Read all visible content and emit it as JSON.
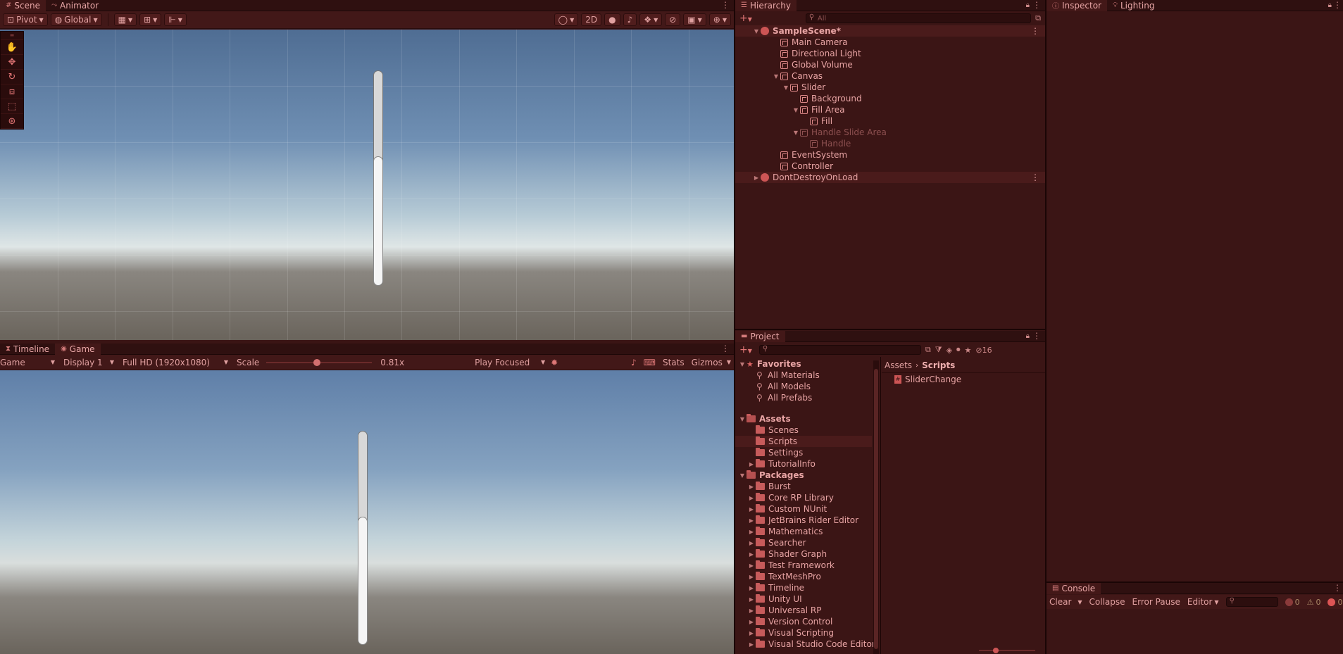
{
  "scene_window": {
    "tabs": [
      {
        "label": "Scene",
        "icon": "grid-icon"
      },
      {
        "label": "Animator",
        "icon": "animator-icon"
      }
    ],
    "toolbar": {
      "pivot_label": "Pivot",
      "global_label": "Global",
      "mode_2d_label": "2D"
    },
    "tools": [
      "hand-tool-icon",
      "move-tool-icon",
      "rotate-tool-icon",
      "scale-tool-icon",
      "rect-tool-icon",
      "transform-tool-icon"
    ],
    "slider_fill_fraction": 0.6
  },
  "game_window": {
    "tabs": [
      {
        "label": "Timeline",
        "icon": "timeline-icon"
      },
      {
        "label": "Game",
        "icon": "gamepad-icon"
      }
    ],
    "toolbar": {
      "game_select": "Game",
      "display_select": "Display 1",
      "resolution_select": "Full HD (1920x1080)",
      "scale_label": "Scale",
      "scale_value": "0.81x",
      "scale_fraction": 0.48,
      "play_focused": "Play Focused",
      "stats_label": "Stats",
      "gizmos_label": "Gizmos"
    },
    "slider_fill_fraction": 0.6
  },
  "hierarchy": {
    "tab_label": "Hierarchy",
    "search_placeholder": "All",
    "rows": [
      {
        "label": "SampleScene*",
        "depth": 0,
        "type": "scene",
        "expanded": true,
        "dim": false,
        "bold": true
      },
      {
        "label": "Main Camera",
        "depth": 1,
        "type": "object",
        "expanded": null,
        "dim": false
      },
      {
        "label": "Directional Light",
        "depth": 1,
        "type": "object",
        "expanded": null,
        "dim": false
      },
      {
        "label": "Global Volume",
        "depth": 1,
        "type": "object",
        "expanded": null,
        "dim": false
      },
      {
        "label": "Canvas",
        "depth": 1,
        "type": "object",
        "expanded": true,
        "dim": false
      },
      {
        "label": "Slider",
        "depth": 2,
        "type": "object",
        "expanded": true,
        "dim": false
      },
      {
        "label": "Background",
        "depth": 3,
        "type": "object",
        "expanded": null,
        "dim": false
      },
      {
        "label": "Fill Area",
        "depth": 3,
        "type": "object",
        "expanded": true,
        "dim": false
      },
      {
        "label": "Fill",
        "depth": 4,
        "type": "object",
        "expanded": null,
        "dim": false
      },
      {
        "label": "Handle Slide Area",
        "depth": 3,
        "type": "object",
        "expanded": true,
        "dim": true
      },
      {
        "label": "Handle",
        "depth": 4,
        "type": "object",
        "expanded": null,
        "dim": true
      },
      {
        "label": "EventSystem",
        "depth": 1,
        "type": "object",
        "expanded": null,
        "dim": false
      },
      {
        "label": "Controller",
        "depth": 1,
        "type": "object",
        "expanded": null,
        "dim": false
      },
      {
        "label": "DontDestroyOnLoad",
        "depth": 0,
        "type": "scene",
        "expanded": false,
        "dim": false
      }
    ]
  },
  "inspector": {
    "tabs": [
      {
        "label": "Inspector",
        "icon": "info-icon"
      },
      {
        "label": "Lighting",
        "icon": "bulb-icon"
      }
    ]
  },
  "project": {
    "tab_label": "Project",
    "hidden_count": "16",
    "breadcrumb": [
      "Assets",
      "Scripts"
    ],
    "favorites_label": "Favorites",
    "favorites": [
      "All Materials",
      "All Models",
      "All Prefabs"
    ],
    "assets_label": "Assets",
    "assets": [
      {
        "label": "Scenes",
        "has_children": false,
        "selected": false
      },
      {
        "label": "Scripts",
        "has_children": false,
        "selected": true
      },
      {
        "label": "Settings",
        "has_children": false,
        "selected": false
      },
      {
        "label": "TutorialInfo",
        "has_children": true,
        "selected": false
      }
    ],
    "packages_label": "Packages",
    "packages": [
      "Burst",
      "Core RP Library",
      "Custom NUnit",
      "JetBrains Rider Editor",
      "Mathematics",
      "Searcher",
      "Shader Graph",
      "Test Framework",
      "TextMeshPro",
      "Timeline",
      "Unity UI",
      "Universal RP",
      "Version Control",
      "Visual Scripting",
      "Visual Studio Code Editor"
    ],
    "files": [
      {
        "label": "SliderChange",
        "icon": "script-icon"
      }
    ]
  },
  "console": {
    "tab_label": "Console",
    "clear_label": "Clear",
    "collapse_label": "Collapse",
    "error_pause_label": "Error Pause",
    "editor_label": "Editor",
    "log_count": "0",
    "warning_count": "0",
    "error_count": "0"
  },
  "colors": {
    "accent": "#e07474",
    "panel_bg": "#3b1515",
    "header_bg": "#2f1010"
  }
}
